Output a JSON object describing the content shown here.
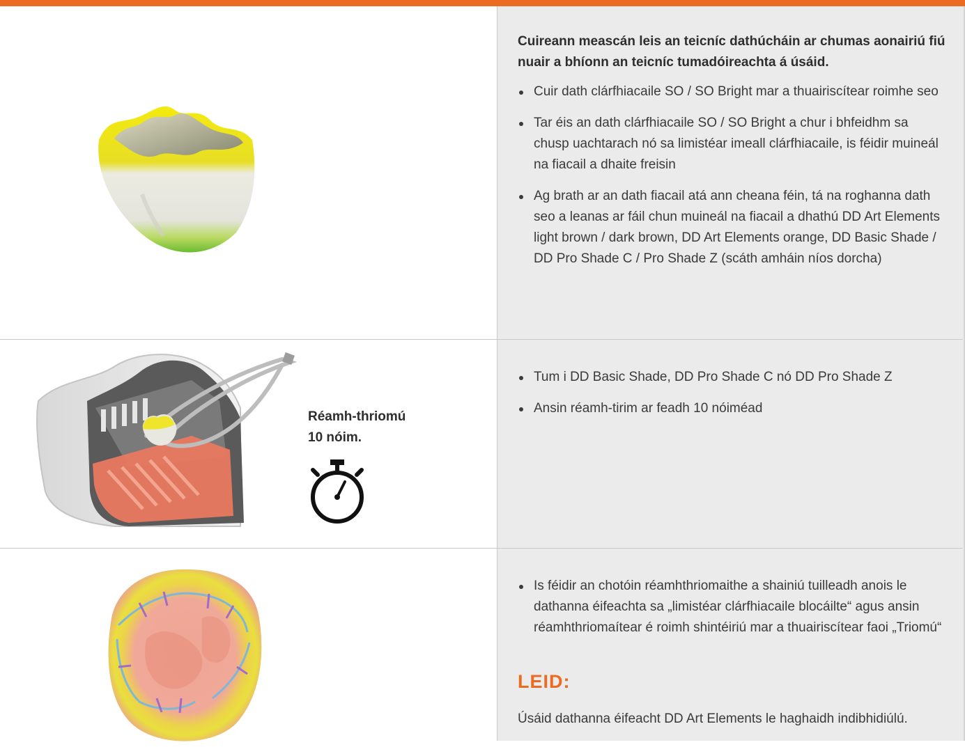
{
  "colors": {
    "accent": "#ec6b22",
    "panel": "#ebebeb",
    "divider": "#c9c9c9"
  },
  "rows": [
    {
      "illustration": "crown-yellow-green-painted",
      "heading": "Cuireann meascán leis an teicníc dathúcháin ar chumas aonairiú fiú nuair a bhíonn an teicníc tumadóireachta á úsáid.",
      "bullets": [
        "Cuir dath clárfhiacaile SO / SO Bright mar a thuairiscítear roimhe seo",
        "Tar éis an dath clárfhiacaile SO / SO Bright a chur i bhfeidhm sa chusp uachtarach nó sa limistéar imeall clárfhiacaile, is féidir muineál na fiacail a dhaite freisin",
        "Ag brath ar an dath fiacail atá ann cheana féin, tá na roghanna dath seo a leanas ar fáil chun muineál na fiacail a dhathú DD Art Elements light brown / dark brown, DD Art Elements orange, DD Basic Shade / DD Pro Shade C / Pro Shade Z (scáth amháin níos dorcha)"
      ]
    },
    {
      "illustration": "pre-drying-oven-with-crown",
      "label_line1": "Réamh-thriomú",
      "label_line2": "10 nóim.",
      "icon": "stopwatch-icon",
      "bullets": [
        "Tum i DD Basic Shade, DD Pro Shade C nó DD Pro Shade Z",
        "Ansin réamh-tirim ar feadh 10 nóiméad"
      ]
    },
    {
      "illustration": "crown-occlusal-view-effect-colors",
      "bullets": [
        "Is féidir an chotóin réamhthriomaithe a shainiú tuilleadh anois le dathanna éifeachta sa „limistéar clárfhiacaile blocáilte“ agus ansin réamhthriomaítear é roimh shintéiriú mar a thuairiscítear faoi „Triomú“"
      ],
      "tip_title": "LEID:",
      "tip_text": "Úsáid dathanna éifeacht DD Art Elements le haghaidh indibhidiúlú."
    }
  ]
}
